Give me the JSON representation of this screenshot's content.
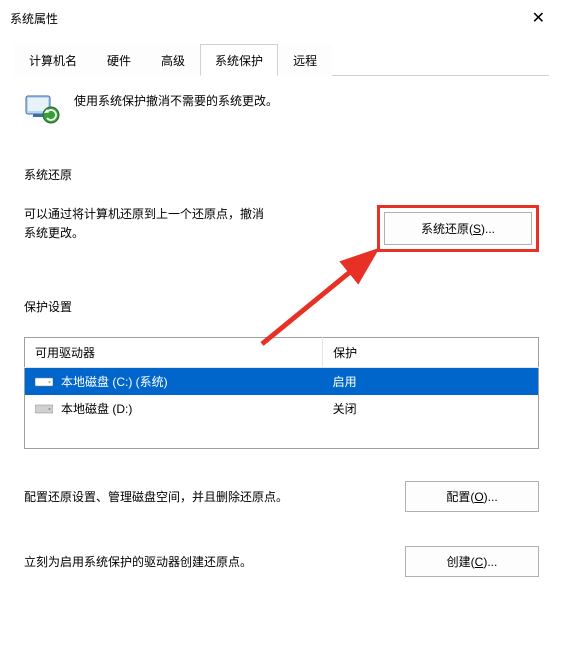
{
  "window": {
    "title": "系统属性",
    "close": "✕"
  },
  "tabs": [
    {
      "label": "计算机名"
    },
    {
      "label": "硬件"
    },
    {
      "label": "高级"
    },
    {
      "label": "系统保护",
      "active": true
    },
    {
      "label": "远程"
    }
  ],
  "intro": "使用系统保护撤消不需要的系统更改。",
  "section_restore": {
    "title": "系统还原",
    "desc": "可以通过将计算机还原到上一个还原点，撤消系统更改。",
    "button_prefix": "系统还原(",
    "button_key": "S",
    "button_suffix": ")..."
  },
  "section_protect": {
    "title": "保护设置",
    "table": {
      "headers": {
        "drive": "可用驱动器",
        "protect": "保护"
      },
      "rows": [
        {
          "name": "本地磁盘 (C:) (系统)",
          "protect": "启用",
          "selected": true
        },
        {
          "name": "本地磁盘 (D:)",
          "protect": "关闭",
          "selected": false
        }
      ]
    },
    "config_desc": "配置还原设置、管理磁盘空间，并且删除还原点。",
    "config_button_prefix": "配置(",
    "config_button_key": "O",
    "config_button_suffix": ")...",
    "create_desc": "立刻为启用系统保护的驱动器创建还原点。",
    "create_button_prefix": "创建(",
    "create_button_key": "C",
    "create_button_suffix": ")..."
  }
}
